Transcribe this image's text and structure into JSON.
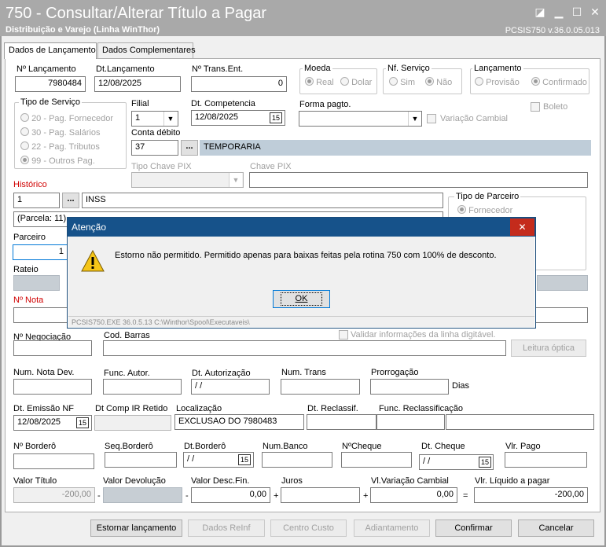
{
  "window": {
    "title": "750 - Consultar/Alterar Título a Pagar",
    "subtitle": "Distribuição e Varejo (Linha WinThor)",
    "version": "PCSIS750  v.36.0.05.013"
  },
  "tabs": [
    "Dados de Lançamento",
    "Dados Complementares"
  ],
  "f": {
    "num_lanc_label": "Nº Lançamento",
    "num_lanc": "7980484",
    "dt_lanc_label": "Dt.Lançamento",
    "dt_lanc": "12/08/2025",
    "trans_label": "Nº Trans.Ent.",
    "trans": "0",
    "moeda_title": "Moeda",
    "real": "Real",
    "dolar": "Dolar",
    "nf_title": "Nf. Serviço",
    "sim": "Sim",
    "nao": "Não",
    "lanc_title": "Lançamento",
    "provisao": "Provisão",
    "confirmado": "Confirmado",
    "boleto": "Boleto",
    "tipo_serv_title": "Tipo de Serviço",
    "ts1": "20 - Pag. Fornecedor",
    "ts2": "30 - Pag. Salários",
    "ts3": "22 - Pag. Tributos",
    "ts4": "99 - Outros Pag.",
    "filial_label": "Filial",
    "filial": "1",
    "dtcomp_label": "Dt. Competencia",
    "dtcomp": "12/08/2025",
    "forma_label": "Forma pagto.",
    "var_cambial": "Variação Cambial",
    "conta_label": "Conta débito",
    "conta": "37",
    "conta_desc": "TEMPORARIA",
    "tipo_pix_label": "Tipo Chave PIX",
    "chave_pix_label": "Chave PIX",
    "hist_label": "Histórico",
    "hist_code": "1",
    "hist_desc": "INSS",
    "hist_line2": "(Parcela: 11)",
    "tipo_parc_title": "Tipo de Parceiro",
    "fornecedor": "Fornecedor",
    "parceiro_label": "Parceiro",
    "parceiro": "1",
    "rateio_label": "Rateio",
    "nota_label": "Nº Nota",
    "valid_digitavel": "Validar informações da linha digitável.",
    "neg_label": "Nº Negociação",
    "codbar_label": "Cod. Barras",
    "leitura": "Leitura óptica",
    "nnd_label": "Num. Nota Dev.",
    "funcaut_label": "Func. Autor.",
    "dtaut_label": "Dt. Autorização",
    "dtaut": "  /  /",
    "numtrans_label": "Num. Trans",
    "prorrog_label": "Prorrogação",
    "dias": "Dias",
    "dtemis_label": "Dt. Emissão NF",
    "dtemis": "12/08/2025",
    "dtcompir_label": "Dt Comp IR Retido",
    "local_label": "Localização",
    "local": "EXCLUSAO DO 7980483",
    "dtreclass_label": "Dt. Reclassif.",
    "funcreclass_label": "Func. Reclassificação",
    "bordero_label": "Nº Borderô",
    "seqbord_label": "Seq.Borderô",
    "dtbord_label": "Dt.Borderô",
    "dtbord": "  /  /",
    "numbanco_label": "Num.Banco",
    "ncheque_label": "NºCheque",
    "dtcheque_label": "Dt. Cheque",
    "dtcheque": "  /  /",
    "vlpago_label": "Vlr. Pago",
    "vtitulo_label": "Valor Título",
    "vtitulo": "-200,00",
    "vdevol_label": "Valor Devolução",
    "vdesc_label": "Valor Desc.Fin.",
    "vdesc": "0,00",
    "juros_label": "Juros",
    "vlvar_label": "Vl.Variação Cambial",
    "vlvar": "0,00",
    "vliq_label": "Vlr. Líquido a pagar",
    "vliq": "-200,00",
    "minus": "-",
    "plus": "+",
    "equals": "="
  },
  "buttons": {
    "estornar": "Estornar lançamento",
    "reinf": "Dados ReInf",
    "centro": "Centro Custo",
    "adiant": "Adiantamento",
    "confirmar": "Confirmar",
    "cancelar": "Cancelar"
  },
  "dialog": {
    "title": "Atenção",
    "message": "Estorno não permitido. Permitido apenas para baixas feitas pela rotina 750 com 100% de desconto.",
    "ok": "OK",
    "status": "PCSIS750.EXE 36.0.5.13 C:\\Winthor\\Spool\\Executaveis\\"
  },
  "icons": {
    "calendar": "15",
    "dots": "...",
    "close": "✕",
    "arrow": "▼",
    "warning": "!"
  }
}
